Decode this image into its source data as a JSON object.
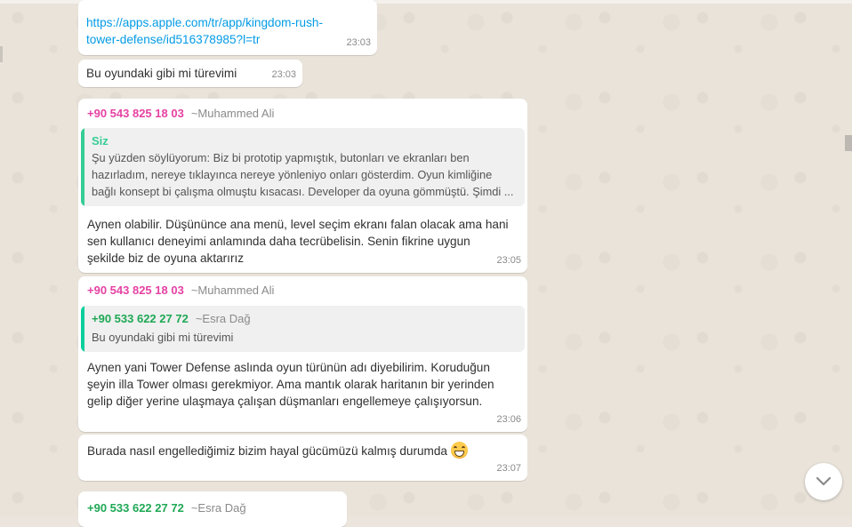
{
  "messages": {
    "m1": {
      "link_line1": "https://apps.apple.com/tr/app/kingdom-rush-",
      "link_line2": "tower-defense/id516378985?l=tr",
      "time": "23:03"
    },
    "m2": {
      "text": "Bu oyundaki gibi mi türevimi",
      "time": "23:03"
    },
    "m3": {
      "sender_phone": "+90 543 825 18 03",
      "sender_alias": "~Muhammed Ali",
      "quote_author": "Siz",
      "quote_lines": [
        "Şu yüzden söylüyorum: Biz bi prototip yapmıştık, butonları ve ekranları ben",
        "hazırladım, nereye tıklayınca nereye yönleniyo onları gösterdim. Oyun kimliğine",
        "bağlı konsept bi çalışma olmuştu kısacası. Developer da oyuna gömmüştü. Şimdi ..."
      ],
      "lines": [
        "Aynen olabilir. Düşününce ana menü, level seçim ekranı falan olacak ama hani",
        "sen kullanıcı deneyimi anlamında daha tecrübelisin. Senin fikrine uygun",
        "şekilde biz de oyuna aktarırız"
      ],
      "time": "23:05"
    },
    "m4": {
      "sender_phone": "+90 543 825 18 03",
      "sender_alias": "~Muhammed Ali",
      "quote_phone": "+90 533 622 27 72",
      "quote_alias": "~Esra Dağ",
      "quote_text": "Bu oyundaki gibi mi türevimi",
      "lines": [
        "Aynen yani Tower Defense aslında oyun türünün adı diyebilirim. Koruduğun",
        "şeyin illa Tower olması gerekmiyor. Ama mantık olarak haritanın bir yerinden",
        "gelip diğer yerine ulaşmaya çalışan düşmanları engellemeye çalışıyorsun."
      ],
      "time": "23:06"
    },
    "m5": {
      "text": "Burada nasıl engellediğimiz bizim hayal gücümüzü kalmış durumda",
      "emoji": "grinning-face-emoji",
      "time": "23:07"
    },
    "m6": {
      "sender_phone": "+90 533 622 27 72",
      "sender_alias": "~Esra Dağ"
    }
  },
  "colors": {
    "sender_pink": "#e542a3",
    "sender_green": "#1fa855",
    "quote_self_bar": "#35cd96",
    "quote_other_bar": "#06cf9c",
    "link": "#039be5",
    "wallpaper": "#e9e3da"
  },
  "icons": {
    "scroll_down": "chevron-down-icon"
  }
}
